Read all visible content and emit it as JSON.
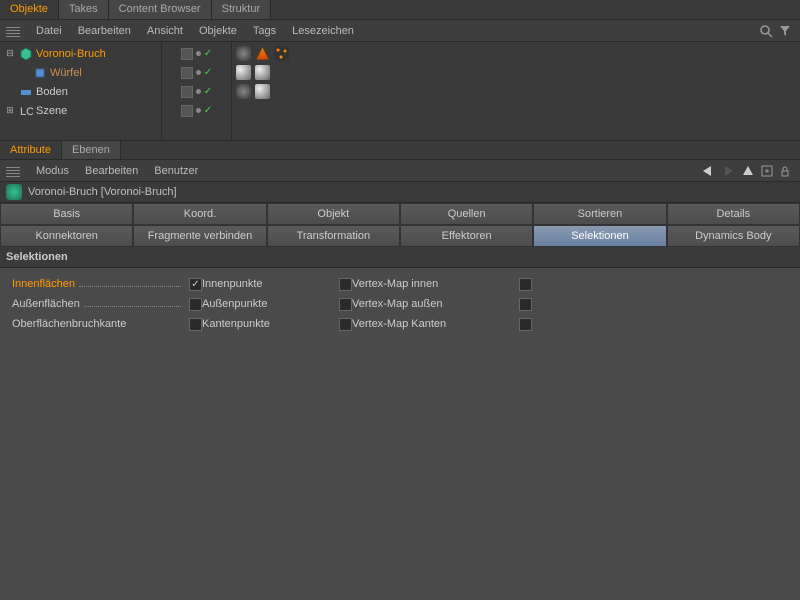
{
  "topTabs": {
    "objekte": "Objekte",
    "takes": "Takes",
    "contentBrowser": "Content Browser",
    "struktur": "Struktur"
  },
  "objMenu": {
    "datei": "Datei",
    "bearbeiten": "Bearbeiten",
    "ansicht": "Ansicht",
    "objekte": "Objekte",
    "tags": "Tags",
    "lesezeichen": "Lesezeichen"
  },
  "tree": {
    "voronoi": "Voronoi-Bruch",
    "wuerfel": "Würfel",
    "boden": "Boden",
    "szene": "Szene"
  },
  "attrTabs": {
    "attribute": "Attribute",
    "ebenen": "Ebenen"
  },
  "attrMenu": {
    "modus": "Modus",
    "bearbeiten": "Bearbeiten",
    "benutzer": "Benutzer"
  },
  "objectTitle": "Voronoi-Bruch [Voronoi-Bruch]",
  "paramTabs": {
    "basis": "Basis",
    "koord": "Koord.",
    "objekt": "Objekt",
    "quellen": "Quellen",
    "sortieren": "Sortieren",
    "details": "Details",
    "konnektoren": "Konnektoren",
    "fragmente": "Fragmente verbinden",
    "transformation": "Transformation",
    "effektoren": "Effektoren",
    "selektionen": "Selektionen",
    "dynamics": "Dynamics Body"
  },
  "sectionTitle": "Selektionen",
  "fields": {
    "innenflaechen": "Innenflächen",
    "aussenflaechen": "Außenflächen",
    "oberflaechenbruchkante": "Oberflächenbruchkante",
    "innenpunkte": "Innenpunkte",
    "aussenpunkte": "Außenpunkte",
    "kantenpunkte": "Kantenpunkte",
    "vmapInnen": "Vertex-Map innen",
    "vmapAussen": "Vertex-Map außen",
    "vmapKanten": "Vertex-Map Kanten"
  }
}
